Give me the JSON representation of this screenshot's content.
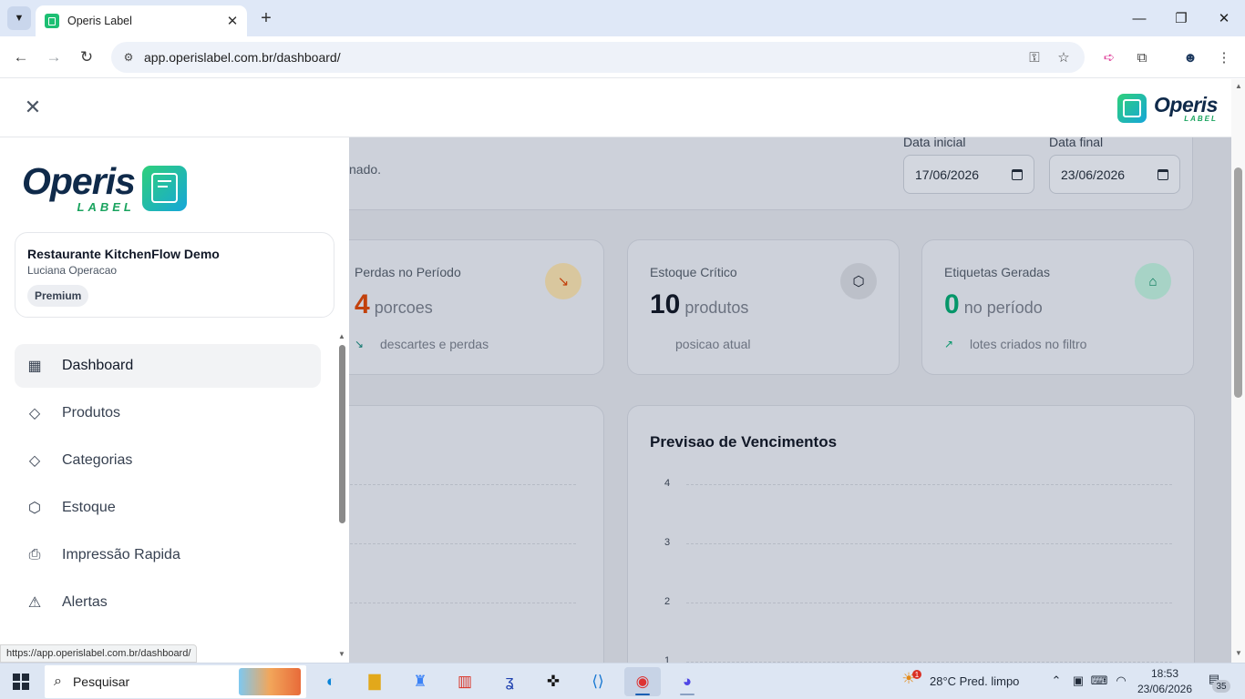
{
  "browser": {
    "tab_title": "Operis Label",
    "url": "app.operislabel.com.br/dashboard/",
    "status_url": "https://app.operislabel.com.br/dashboard/"
  },
  "app": {
    "logo_main": "Operis",
    "logo_sub": "LABEL",
    "colors": {
      "brand_green": "#19a35e",
      "brand_navy": "#0f2a4a",
      "loss_orange": "#c2410c",
      "labels_green": "#059669"
    }
  },
  "sidebar": {
    "org_name": "Restaurante KitchenFlow Demo",
    "user_name": "Luciana Operacao",
    "plan": "Premium",
    "items": [
      {
        "label": "Dashboard",
        "icon": "grid-icon",
        "active": true
      },
      {
        "label": "Produtos",
        "icon": "tag-icon"
      },
      {
        "label": "Categorias",
        "icon": "tag-icon"
      },
      {
        "label": "Estoque",
        "icon": "package-icon"
      },
      {
        "label": "Impressão Rapida",
        "icon": "printer-icon"
      },
      {
        "label": "Alertas",
        "icon": "alert-triangle-icon"
      }
    ]
  },
  "filters": {
    "partial_text": "nado.",
    "start_label": "Data inicial",
    "start_value": "17/06/2026",
    "end_label": "Data final",
    "end_value": "23/06/2026"
  },
  "stats": [
    {
      "title": "Perdas no Período",
      "value": "4",
      "unit": "porcoes",
      "foot": "descartes e perdas",
      "icon": "trending-down-icon"
    },
    {
      "title": "Estoque Crítico",
      "value": "10",
      "unit": "produtos",
      "foot": "posicao atual",
      "icon": "package-icon"
    },
    {
      "title": "Etiquetas Geradas",
      "value": "0",
      "unit": "no período",
      "foot": "lotes criados no filtro",
      "icon": "chef-hat-icon"
    }
  ],
  "expiry_chart": {
    "title": "Previsao de Vencimentos",
    "y_ticks": [
      "4",
      "3",
      "2",
      "1"
    ]
  },
  "taskbar": {
    "search_label": "Pesquisar",
    "weather": "28°C  Pred. limpo",
    "weather_alert": "1",
    "time": "18:53",
    "date": "23/06/2026",
    "notifications": "35"
  }
}
